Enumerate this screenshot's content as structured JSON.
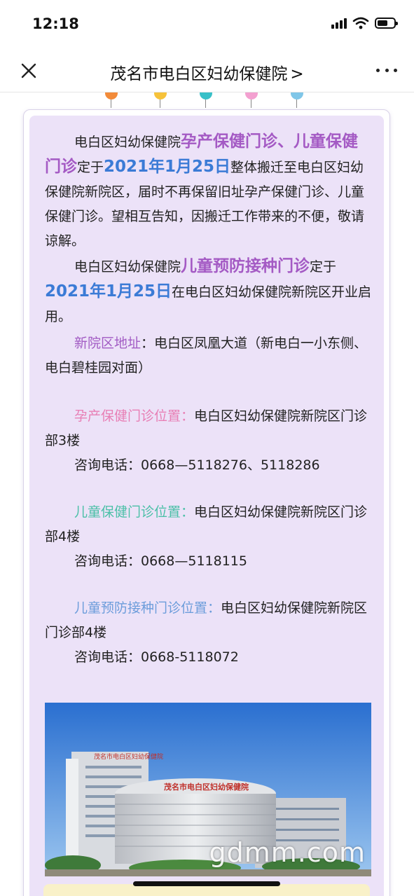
{
  "status": {
    "time": "12:18"
  },
  "nav": {
    "title": "茂名市电白区妇幼保健院",
    "chevron": ">"
  },
  "notice": {
    "p1_prefix": "电白区妇幼保健院",
    "p1_highlight": "孕产保健门诊、儿童保健门诊",
    "p1_mid": "定于",
    "p1_date": "2021年1月25日",
    "p1_suffix": "整体搬迁至电白区妇幼保健院新院区，届时不再保留旧址孕产保健门诊、儿童保健门诊。望相互告知，因搬迁工作带来的不便，敬请谅解。",
    "p2_prefix": "电白区妇幼保健院",
    "p2_highlight": "儿童预防接种门诊",
    "p2_mid": "定于",
    "p2_date": "2021年1月25日",
    "p2_suffix": "在电白区妇幼保健院新院区开业启用。",
    "address_label": "新院区地址",
    "address_value": "：电白区凤凰大道（新电白一小东侧、电白碧桂园对面）",
    "maternal_label": "孕产保健门诊位置：",
    "maternal_location": "电白区妇幼保健院新院区门诊部3楼",
    "maternal_phone": "咨询电话：0668—5118276、5118286",
    "child_label": "儿童保健门诊位置：",
    "child_location": "电白区妇幼保健院新院区门诊部4楼",
    "child_phone": "咨询电话：0668—5118115",
    "vaccine_label": "儿童预防接种门诊位置：",
    "vaccine_location": "电白区妇幼保健院新院区门诊部4楼",
    "vaccine_phone": "咨询电话：0668-5118072"
  },
  "photo": {
    "building_sign_top": "茂名市电白区妇幼保健院",
    "building_sign_front": "茂名市电白区妇幼保健院",
    "watermark": "gdmm.com"
  },
  "icons": {
    "close": "close-icon",
    "more": "more-icon",
    "wifi": "wifi-icon",
    "signal": "signal-icon",
    "battery": "battery-icon"
  }
}
